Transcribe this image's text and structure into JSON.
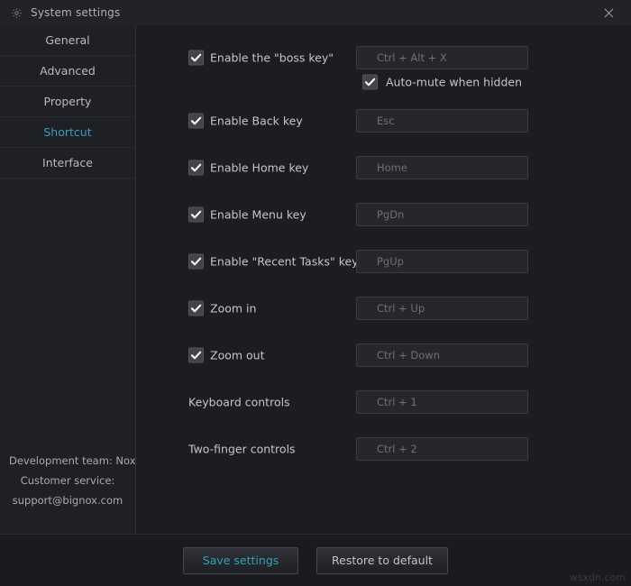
{
  "window": {
    "title": "System settings",
    "gear_icon": "gear-icon",
    "close_icon": "close-icon"
  },
  "sidebar": {
    "items": [
      {
        "label": "General",
        "active": false
      },
      {
        "label": "Advanced",
        "active": false
      },
      {
        "label": "Property",
        "active": false
      },
      {
        "label": "Shortcut",
        "active": true
      },
      {
        "label": "Interface",
        "active": false
      }
    ],
    "credits": {
      "line1": "Development team: Nox",
      "line2": "Customer service:",
      "line3": "support@bignox.com"
    }
  },
  "main": {
    "rows": [
      {
        "label": "Enable the \"boss key\"",
        "checkbox": true,
        "checked": true,
        "value": "Ctrl + Alt + X"
      },
      {
        "label": "Enable Back key",
        "checkbox": true,
        "checked": true,
        "value": "Esc"
      },
      {
        "label": "Enable Home key",
        "checkbox": true,
        "checked": true,
        "value": "Home"
      },
      {
        "label": "Enable Menu key",
        "checkbox": true,
        "checked": true,
        "value": "PgDn"
      },
      {
        "label": "Enable \"Recent Tasks\" key",
        "checkbox": true,
        "checked": true,
        "value": "PgUp"
      },
      {
        "label": "Zoom in",
        "checkbox": true,
        "checked": true,
        "value": "Ctrl + Up"
      },
      {
        "label": "Zoom out",
        "checkbox": true,
        "checked": true,
        "value": "Ctrl + Down"
      },
      {
        "label": "Keyboard controls",
        "checkbox": false,
        "checked": false,
        "value": "Ctrl + 1"
      },
      {
        "label": "Two-finger controls",
        "checkbox": false,
        "checked": false,
        "value": "Ctrl + 2"
      }
    ],
    "automute": {
      "label": "Auto-mute when hidden",
      "checked": true
    }
  },
  "footer": {
    "save_label": "Save settings",
    "restore_label": "Restore to default"
  },
  "watermark": "wsxdn.com",
  "colors": {
    "accent": "#2ea3b8",
    "window_bg": "#1c1d21",
    "sidebar_bg": "#1f2025",
    "titlebar_bg": "#222328",
    "input_bg": "#26272c",
    "text": "#c4c6cb",
    "placeholder_text": "#6f7077"
  }
}
